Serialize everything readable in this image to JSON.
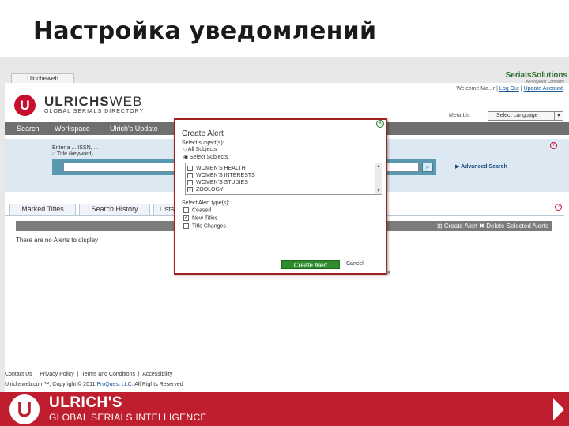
{
  "slide": {
    "title": "Настройка уведомлений"
  },
  "browser": {
    "tab": "Ulricheweb"
  },
  "header": {
    "partner": "SerialsSolutions",
    "partner_sub": "A ProQuest Company",
    "welcome": "Welcome Ma...r",
    "links": [
      "Log Out",
      "Update Account"
    ],
    "logo_mark": "U",
    "logo_main": "ULRICHS",
    "logo_web": "WEB",
    "logo_sub": "GLOBAL SERIALS DIRECTORY",
    "meta_label": "Meta Lis",
    "language": "Select Language"
  },
  "nav": {
    "items": [
      "Search",
      "Workspace",
      "Ulrich's Update"
    ]
  },
  "search": {
    "prompt": "Enter a ... ISSN, ...",
    "radio": "Title (keyword)",
    "advanced": "Advanced Search",
    "go_icon": "search-icon"
  },
  "tabs": [
    "Marked Titles",
    "Search History",
    "Lists"
  ],
  "alerts": {
    "create": "Create Alert",
    "delete": "Delete Selected Alerts",
    "empty": "There are no Alerts to display"
  },
  "footer": {
    "links": [
      "Contact Us",
      "Privacy Policy",
      "Terms and Conditions",
      "Accessibility"
    ],
    "copyright": "Ulrichsweb.com™, Copyright © 2011",
    "company": "ProQuest LLC",
    "rights": "All Rights Reserved"
  },
  "brand": {
    "mark": "U",
    "name": "ULRICH'S",
    "tag": "GLOBAL SERIALS INTELLIGENCE"
  },
  "modal": {
    "title": "Create Alert",
    "close": "×",
    "subjects_label": "Select subject(s):",
    "opt_all": "All Subjects",
    "opt_select": "Select Subjects",
    "subjects": [
      {
        "label": "WOMEN'S HEALTH",
        "checked": false
      },
      {
        "label": "WOMEN'S INTERESTS",
        "checked": false
      },
      {
        "label": "WOMEN'S STUDIES",
        "checked": false
      },
      {
        "label": "ZOOLOGY",
        "checked": true
      }
    ],
    "types_label": "Select Alert type(s):",
    "types": [
      {
        "label": "Ceased",
        "checked": false
      },
      {
        "label": "New Titles",
        "checked": true
      },
      {
        "label": "Title Changes",
        "checked": false
      }
    ],
    "create_btn": "Create Alert",
    "cancel": "Cancel"
  }
}
